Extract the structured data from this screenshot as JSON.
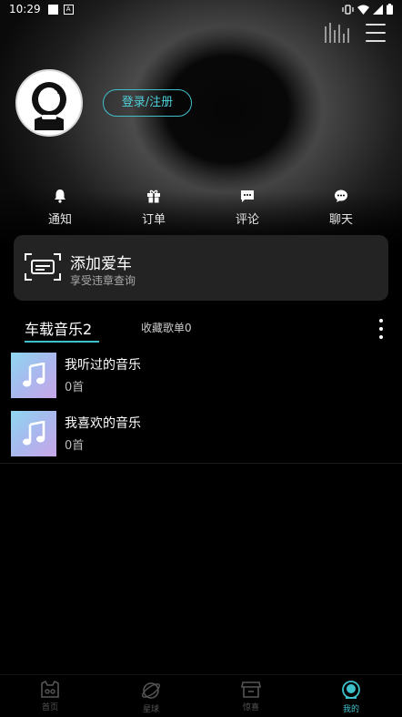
{
  "status_bar": {
    "time": "10:29",
    "badge": "A"
  },
  "header": {
    "login_label": "登录/注册"
  },
  "quick_actions": [
    {
      "label": "通知",
      "icon": "bell-icon"
    },
    {
      "label": "订单",
      "icon": "gift-icon"
    },
    {
      "label": "评论",
      "icon": "comment-icon"
    },
    {
      "label": "聊天",
      "icon": "chat-icon"
    }
  ],
  "car_card": {
    "title": "添加爱车",
    "subtitle": "享受违章查询",
    "icon": "car-plate-icon"
  },
  "music": {
    "tab_active": "车载音乐2",
    "tab_fav": "收藏歌单0",
    "items": [
      {
        "title": "我听过的音乐",
        "count": "0首"
      },
      {
        "title": "我喜欢的音乐",
        "count": "0首"
      }
    ]
  },
  "bottom_nav": [
    {
      "label": "首页",
      "icon": "home-icon",
      "active": false
    },
    {
      "label": "星球",
      "icon": "planet-icon",
      "active": false
    },
    {
      "label": "惊喜",
      "icon": "store-icon",
      "active": false
    },
    {
      "label": "我的",
      "icon": "profile-icon",
      "active": true
    }
  ],
  "colors": {
    "accent": "#3fc1cc",
    "card": "#232323",
    "background": "#000000"
  }
}
